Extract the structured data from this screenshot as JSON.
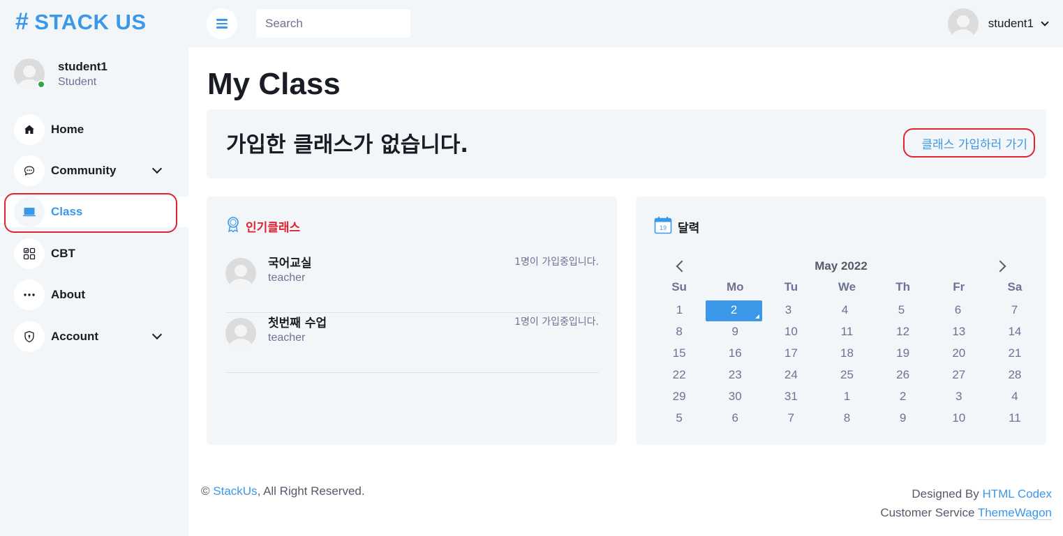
{
  "brand": {
    "hash": "#",
    "name": "STACK US"
  },
  "sidebar": {
    "user": {
      "name": "student1",
      "role": "Student"
    },
    "items": [
      {
        "label": "Home",
        "icon": "home-icon"
      },
      {
        "label": "Community",
        "icon": "chat-icon"
      },
      {
        "label": "Class",
        "icon": "laptop-icon"
      },
      {
        "label": "CBT",
        "icon": "checklist-icon"
      },
      {
        "label": "About",
        "icon": "ellipsis-icon"
      },
      {
        "label": "Account",
        "icon": "shield-icon"
      }
    ],
    "active": "Class"
  },
  "topbar": {
    "search_placeholder": "Search",
    "user_name": "student1"
  },
  "main": {
    "title": "My Class",
    "notice": {
      "text": "가입한 클래스가 없습니다.",
      "link": "클래스 가입하러 가기"
    },
    "popular": {
      "title": "인기클래스",
      "classes": [
        {
          "name": "국어교실",
          "teacher": "teacher",
          "count": "1명이 가입중입니다."
        },
        {
          "name": "첫번째 수업",
          "teacher": "teacher",
          "count": "1명이 가입중입니다."
        }
      ]
    },
    "calendar": {
      "title": "달력",
      "icon_day": "19",
      "month": "May 2022",
      "weekdays": [
        "Su",
        "Mo",
        "Tu",
        "We",
        "Th",
        "Fr",
        "Sa"
      ],
      "weeks": [
        [
          "1",
          "2",
          "3",
          "4",
          "5",
          "6",
          "7"
        ],
        [
          "8",
          "9",
          "10",
          "11",
          "12",
          "13",
          "14"
        ],
        [
          "15",
          "16",
          "17",
          "18",
          "19",
          "20",
          "21"
        ],
        [
          "22",
          "23",
          "24",
          "25",
          "26",
          "27",
          "28"
        ],
        [
          "29",
          "30",
          "31",
          "1",
          "2",
          "3",
          "4"
        ],
        [
          "5",
          "6",
          "7",
          "8",
          "9",
          "10",
          "11"
        ]
      ],
      "selected": "2"
    }
  },
  "footer": {
    "copyright": "©",
    "site_link": "StackUs",
    "rights": ", All Right Reserved.",
    "designed_by": "Designed By",
    "designer_link": "HTML Codex",
    "service": "Customer Service",
    "service_link": "ThemeWagon"
  },
  "colors": {
    "accent": "#3b97e8",
    "highlight": "#e0232e",
    "panel": "#f3f6f9",
    "online": "#2ba84a"
  }
}
